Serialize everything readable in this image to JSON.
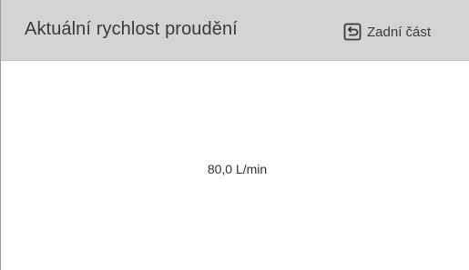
{
  "header": {
    "title": "Aktuální rychlost proudění",
    "back_label": "Zadní část",
    "back_icon": "return-arrow-icon"
  },
  "main": {
    "flow_rate": "80,0 L/min"
  },
  "colors": {
    "header_background": "#d4d4d4",
    "page_background": "#ffffff",
    "text": "#3a3a3a"
  }
}
